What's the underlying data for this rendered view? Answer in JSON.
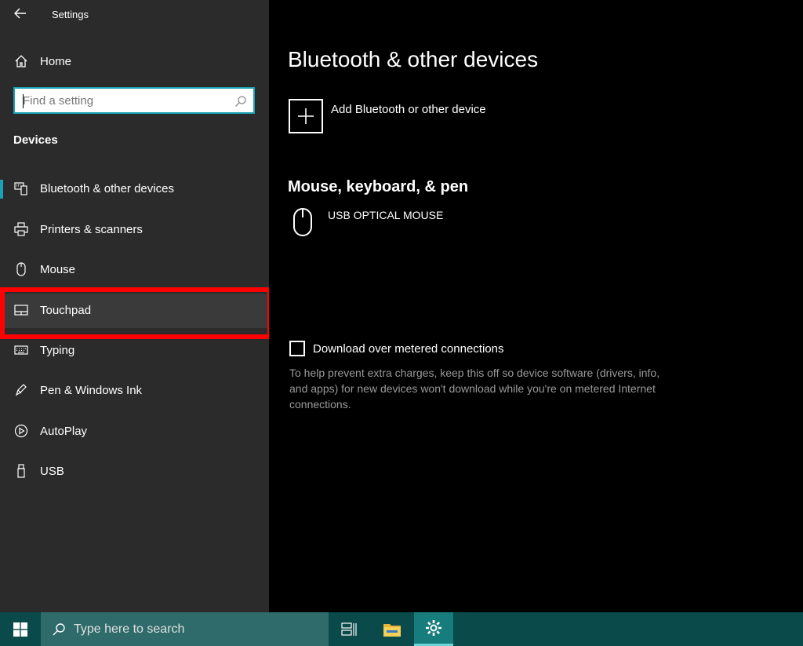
{
  "window": {
    "title": "Settings"
  },
  "sidebar": {
    "home_label": "Home",
    "search_placeholder": "Find a setting",
    "section_header": "Devices",
    "items": [
      {
        "label": "Bluetooth & other devices",
        "icon": "bluetooth-devices-icon",
        "selected": true
      },
      {
        "label": "Printers & scanners",
        "icon": "printer-icon"
      },
      {
        "label": "Mouse",
        "icon": "mouse-icon"
      },
      {
        "label": "Touchpad",
        "icon": "touchpad-icon",
        "highlighted": true
      },
      {
        "label": "Typing",
        "icon": "keyboard-icon"
      },
      {
        "label": "Pen & Windows Ink",
        "icon": "pen-icon"
      },
      {
        "label": "AutoPlay",
        "icon": "autoplay-icon"
      },
      {
        "label": "USB",
        "icon": "usb-icon"
      }
    ]
  },
  "main": {
    "title": "Bluetooth & other devices",
    "add_device_label": "Add Bluetooth or other device",
    "section_title": "Mouse, keyboard, & pen",
    "devices": [
      {
        "name": "USB OPTICAL MOUSE",
        "icon": "mouse-icon"
      }
    ],
    "metered_label": "Download over metered connections",
    "metered_checked": false,
    "metered_help": "To help prevent extra charges, keep this off so device software (drivers, info, and apps) for new devices won't download while you're on metered Internet connections."
  },
  "taskbar": {
    "search_placeholder": "Type here to search"
  },
  "colors": {
    "accent": "#1aa3b5",
    "highlight_frame": "#ff0000",
    "taskbar": "#0a4a4a"
  }
}
